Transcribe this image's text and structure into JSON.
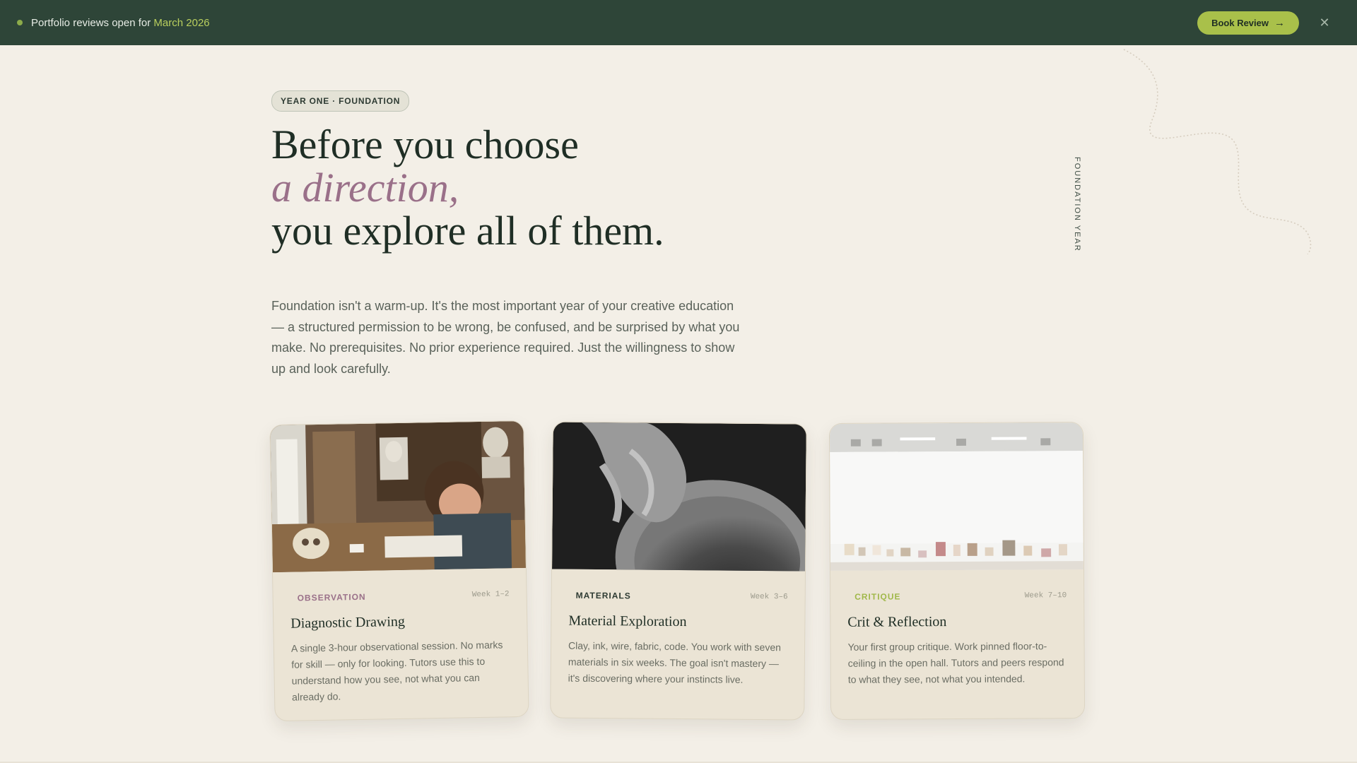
{
  "announcement": {
    "prefix": "Portfolio reviews open for",
    "highlight": "March 2026",
    "button_label": "Book Review",
    "button_arrow": "→",
    "close_label": "✕"
  },
  "side_label": "FOUNDATION YEAR",
  "hero": {
    "pill": "YEAR ONE · FOUNDATION",
    "headline_line1": "Before you choose",
    "headline_line2": "a direction,",
    "headline_line3": "you explore all of them.",
    "intro": "Foundation isn't a warm-up. It's the most important year of your creative education — a structured permission to be wrong, be confused, and be surprised by what you make. No prerequisites. No prior experience required. Just the willingness to show up and look carefully."
  },
  "cards": [
    {
      "tag": "OBSERVATION",
      "week": "Week 1–2",
      "title": "Diagnostic Drawing",
      "desc": "A single 3-hour observational session. No marks for skill — only for looking. Tutors use this to understand how you see, not what you can already do.",
      "image": "student-drawing-photo"
    },
    {
      "tag": "MATERIALS",
      "week": "Week 3–6",
      "title": "Material Exploration",
      "desc": "Clay, ink, wire, fabric, code. You work with seven materials in six weeks. The goal isn't mastery — it's discovering where your instincts live.",
      "image": "clay-pottery-photo"
    },
    {
      "tag": "CRITIQUE",
      "week": "Week 7–10",
      "title": "Crit & Reflection",
      "desc": "Your first group critique. Work pinned floor-to-ceiling in the open hall. Tutors and peers respond to what they see, not what you intended.",
      "image": "gallery-wall-photo"
    }
  ],
  "colors": {
    "bar_bg": "#2e4538",
    "accent_green": "#a9c04a",
    "accent_mauve": "#9a7089",
    "page_bg": "#f3efe7",
    "card_bg": "#ebe4d5"
  }
}
